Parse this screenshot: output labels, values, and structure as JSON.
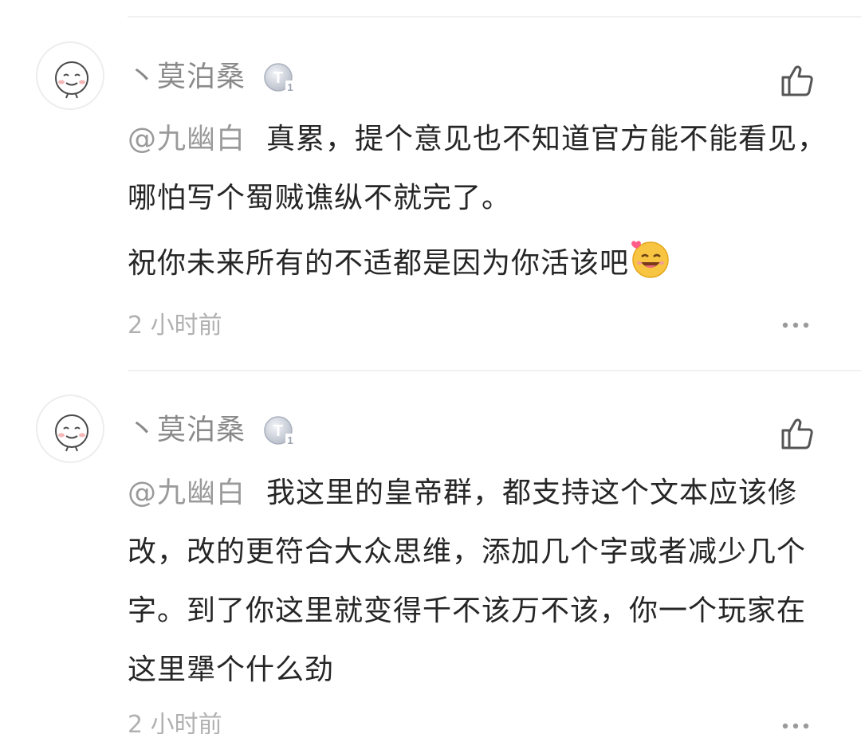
{
  "comments": [
    {
      "username": "丶莫泊桑",
      "badge_letter": "T",
      "badge_level": "1",
      "mention": "@九幽白",
      "paragraphs": [
        "真累，提个意见也不知道官方能不能看见，哪怕写个蜀贼谯纵不就完了。",
        "祝你未来所有的不适都是因为你活该吧"
      ],
      "time": "2 小时前"
    },
    {
      "username": "丶莫泊桑",
      "badge_letter": "T",
      "badge_level": "1",
      "mention": "@九幽白",
      "paragraphs": [
        "我这里的皇帝群，都支持这个文本应该修改，改的更符合大众思维，添加几个字或者减少几个字。到了你这里就变得千不该万不该，你一个玩家在这里犟个什么劲"
      ],
      "time": "2 小时前"
    }
  ],
  "colors": {
    "username": "#8a8a8a",
    "text": "#262626",
    "mention": "#9a9a9a",
    "time": "#b0b0b0",
    "divider": "#f1f1f1"
  }
}
